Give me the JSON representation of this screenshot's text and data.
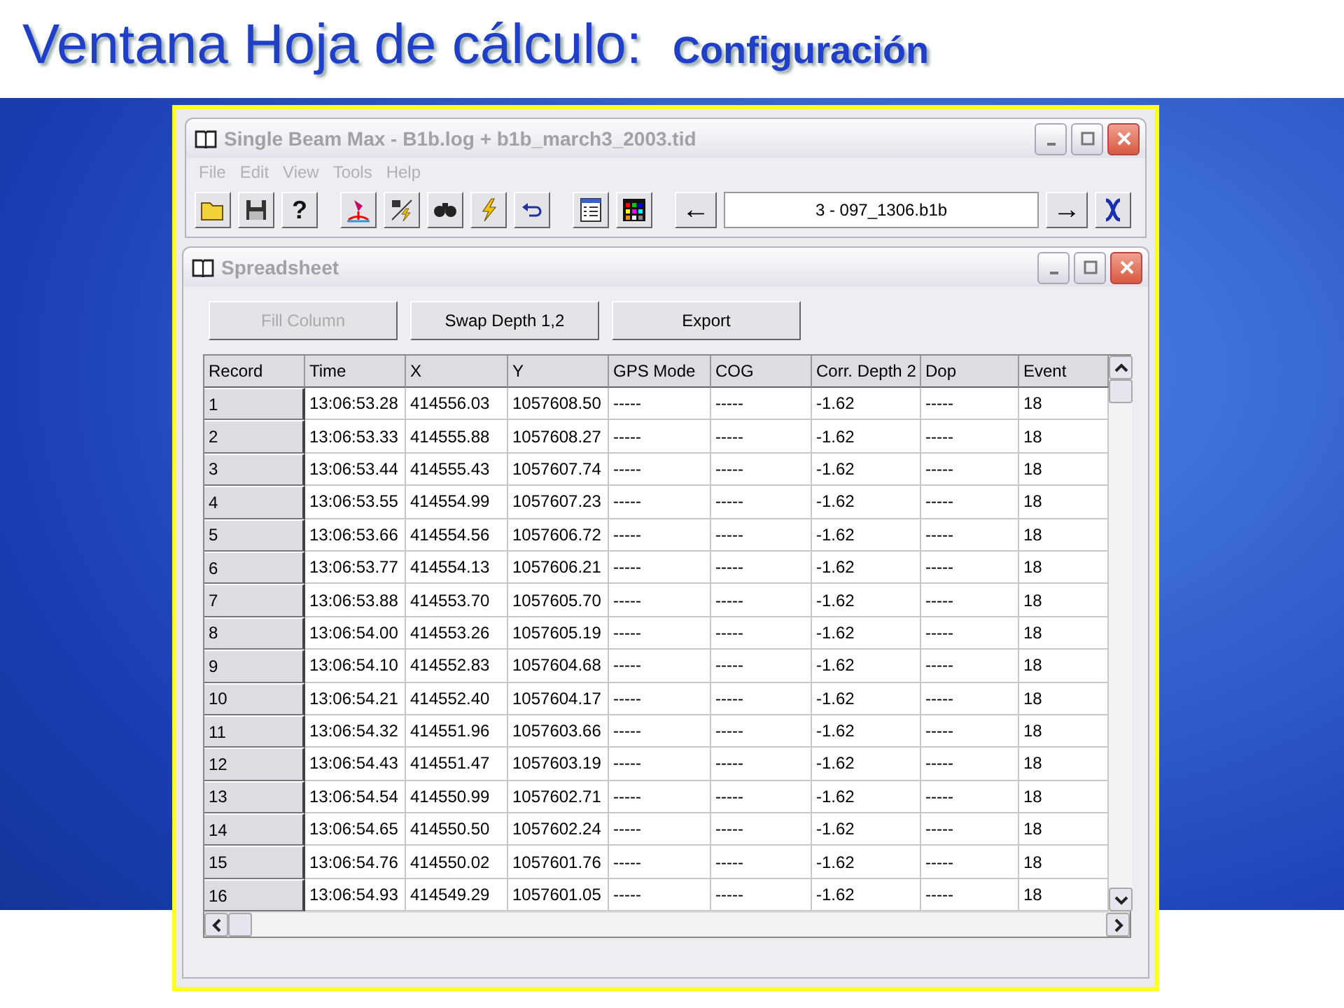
{
  "slide_title": {
    "main": "Ventana Hoja de cálculo:",
    "sub": "Configuración"
  },
  "main_window": {
    "title": "Single Beam Max - B1b.log + b1b_march3_2003.tid",
    "menu": [
      "File",
      "Edit",
      "View",
      "Tools",
      "Help"
    ],
    "toolbar": [
      {
        "kind": "folder"
      },
      {
        "kind": "floppy"
      },
      {
        "kind": "help",
        "label": "?"
      },
      {
        "kind": "marker"
      },
      {
        "kind": "tool-lightning"
      },
      {
        "kind": "binoculars"
      },
      {
        "kind": "lightning"
      },
      {
        "kind": "undo"
      },
      {
        "kind": "list"
      },
      {
        "kind": "palette"
      }
    ],
    "prev_label": "←",
    "file_field": "3 - 097_1306.b1b",
    "next_label": "→"
  },
  "spreadsheet": {
    "title": "Spreadsheet",
    "buttons": [
      {
        "label": "Fill Column",
        "disabled": true
      },
      {
        "label": "Swap Depth 1,2",
        "disabled": false
      },
      {
        "label": "Export",
        "disabled": false
      }
    ],
    "columns": [
      "Record",
      "Time",
      "X",
      "Y",
      "GPS Mode",
      "COG",
      "Corr. Depth 2",
      "Dop",
      "Event"
    ],
    "rows": [
      [
        "1",
        "13:06:53.28",
        "414556.03",
        "1057608.50",
        "-----",
        "-----",
        "-1.62",
        "-----",
        "18"
      ],
      [
        "2",
        "13:06:53.33",
        "414555.88",
        "1057608.27",
        "-----",
        "-----",
        "-1.62",
        "-----",
        "18"
      ],
      [
        "3",
        "13:06:53.44",
        "414555.43",
        "1057607.74",
        "-----",
        "-----",
        "-1.62",
        "-----",
        "18"
      ],
      [
        "4",
        "13:06:53.55",
        "414554.99",
        "1057607.23",
        "-----",
        "-----",
        "-1.62",
        "-----",
        "18"
      ],
      [
        "5",
        "13:06:53.66",
        "414554.56",
        "1057606.72",
        "-----",
        "-----",
        "-1.62",
        "-----",
        "18"
      ],
      [
        "6",
        "13:06:53.77",
        "414554.13",
        "1057606.21",
        "-----",
        "-----",
        "-1.62",
        "-----",
        "18"
      ],
      [
        "7",
        "13:06:53.88",
        "414553.70",
        "1057605.70",
        "-----",
        "-----",
        "-1.62",
        "-----",
        "18"
      ],
      [
        "8",
        "13:06:54.00",
        "414553.26",
        "1057605.19",
        "-----",
        "-----",
        "-1.62",
        "-----",
        "18"
      ],
      [
        "9",
        "13:06:54.10",
        "414552.83",
        "1057604.68",
        "-----",
        "-----",
        "-1.62",
        "-----",
        "18"
      ],
      [
        "10",
        "13:06:54.21",
        "414552.40",
        "1057604.17",
        "-----",
        "-----",
        "-1.62",
        "-----",
        "18"
      ],
      [
        "11",
        "13:06:54.32",
        "414551.96",
        "1057603.66",
        "-----",
        "-----",
        "-1.62",
        "-----",
        "18"
      ],
      [
        "12",
        "13:06:54.43",
        "414551.47",
        "1057603.19",
        "-----",
        "-----",
        "-1.62",
        "-----",
        "18"
      ],
      [
        "13",
        "13:06:54.54",
        "414550.99",
        "1057602.71",
        "-----",
        "-----",
        "-1.62",
        "-----",
        "18"
      ],
      [
        "14",
        "13:06:54.65",
        "414550.50",
        "1057602.24",
        "-----",
        "-----",
        "-1.62",
        "-----",
        "18"
      ],
      [
        "15",
        "13:06:54.76",
        "414550.02",
        "1057601.76",
        "-----",
        "-----",
        "-1.62",
        "-----",
        "18"
      ],
      [
        "16",
        "13:06:54.93",
        "414549.29",
        "1057601.05",
        "-----",
        "-----",
        "-1.62",
        "-----",
        "18"
      ]
    ]
  }
}
